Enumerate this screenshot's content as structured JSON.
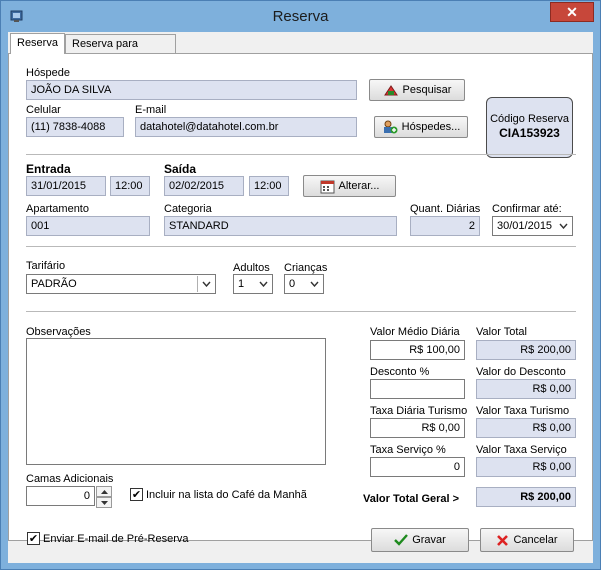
{
  "window": {
    "title": "Reserva",
    "close_label": "✕"
  },
  "tabs": [
    {
      "label": "Reserva"
    },
    {
      "label": "Reserva para Grupos"
    }
  ],
  "guest": {
    "label": "Hóspede",
    "value": "JOÃO DA SILVA",
    "phone_label": "Celular",
    "phone_value": "(11) 7838-4088",
    "email_label": "E-mail",
    "email_value": "datahotel@datahotel.com.br",
    "search_label": "Pesquisar",
    "guests_label": "Hóspedes..."
  },
  "booking_code": {
    "label": "Código Reserva",
    "value": "CIA153923"
  },
  "stay": {
    "checkin_label": "Entrada",
    "checkin_date": "31/01/2015",
    "checkin_time": "12:00",
    "checkout_label": "Saída",
    "checkout_date": "02/02/2015",
    "checkout_time": "12:00",
    "change_label": "Alterar...",
    "room_label": "Apartamento",
    "room_value": "001",
    "category_label": "Categoria",
    "category_value": "STANDARD",
    "nights_label": "Quant. Diárias",
    "nights_value": "2",
    "confirm_label": "Confirmar até:",
    "confirm_value": "30/01/2015"
  },
  "rates": {
    "tariff_label": "Tarifário",
    "tariff_value": "PADRÃO",
    "adults_label": "Adultos",
    "adults_value": "1",
    "children_label": "Crianças",
    "children_value": "0"
  },
  "notes": {
    "label": "Observações"
  },
  "extra_beds": {
    "label": "Camas Adicionais",
    "value": "0"
  },
  "breakfast": {
    "label": "Incluir na lista do Café da Manhã",
    "checked": "✔"
  },
  "values": {
    "avg_daily_label": "Valor Médio Diária",
    "avg_daily_value": "R$ 100,00",
    "total_label": "Valor Total",
    "total_value": "R$ 200,00",
    "discount_pct_label": "Desconto %",
    "discount_pct_value": "",
    "discount_value_label": "Valor do Desconto",
    "discount_value_value": "R$ 0,00",
    "tourism_tax_label": "Taxa Diária Turismo",
    "tourism_tax_value": "R$ 0,00",
    "tourism_total_label": "Valor Taxa Turismo",
    "tourism_total_value": "R$ 0,00",
    "service_pct_label": "Taxa Serviço %",
    "service_pct_value": "0",
    "service_total_label": "Valor Taxa Serviço",
    "service_total_value": "R$ 0,00",
    "grand_total_label": "Valor Total Geral >",
    "grand_total_value": "R$ 200,00"
  },
  "footer": {
    "email_prebooking_label": "Enviar E-mail de Pré-Reserva",
    "email_checked": "✔",
    "save_label": "Gravar",
    "cancel_label": "Cancelar"
  }
}
